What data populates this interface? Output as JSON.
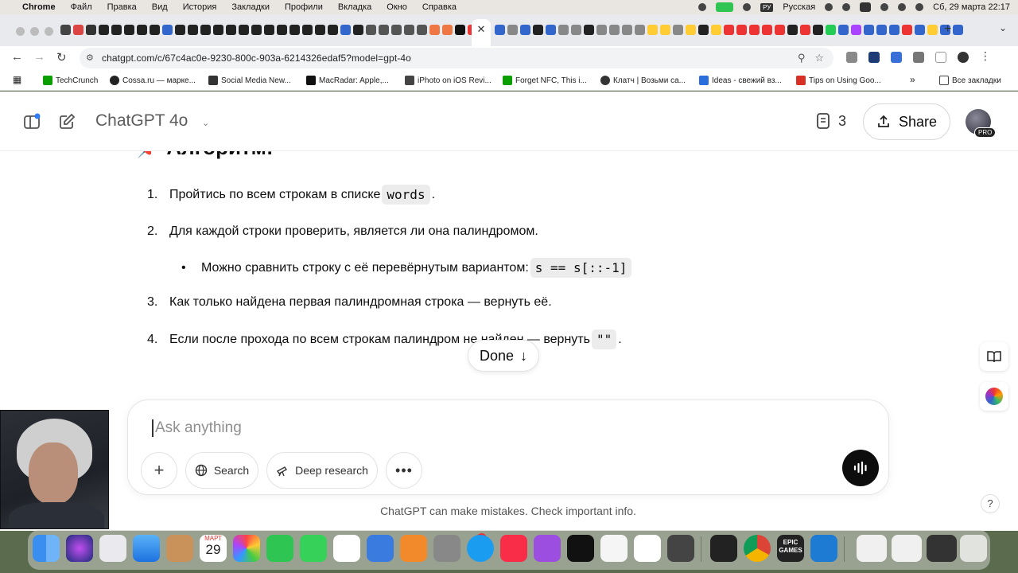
{
  "menubar": {
    "app": "Chrome",
    "items": [
      "Файл",
      "Правка",
      "Вид",
      "История",
      "Закладки",
      "Профили",
      "Вкладка",
      "Окно",
      "Справка"
    ],
    "keyboard_badge": "РУ",
    "keyboard_layout": "Русская",
    "datetime": "Сб, 29 марта  22:17"
  },
  "toolbar": {
    "url": "chatgpt.com/c/67c4ac0e-9230-800c-903a-6214326edaf5?model=gpt-4o"
  },
  "bookmarks": [
    {
      "label": "TechCrunch",
      "color": "#0a9e01"
    },
    {
      "label": "Cossa.ru — марке...",
      "color": "#222222"
    },
    {
      "label": "Social Media New...",
      "color": "#333333"
    },
    {
      "label": "MacRadar: Apple,...",
      "color": "#111111"
    },
    {
      "label": "iPhoto on iOS Revi...",
      "color": "#444444"
    },
    {
      "label": "Forget NFC, This i...",
      "color": "#0a9e01"
    },
    {
      "label": "Клатч | Возьми са...",
      "color": "#333333"
    },
    {
      "label": "Ideas - свежий вз...",
      "color": "#2a6fdb"
    },
    {
      "label": "Tips on Using Goo...",
      "color": "#d93025"
    }
  ],
  "all_bookmarks": "Все закладки",
  "header": {
    "model": "ChatGPT 4o",
    "doc_count": "3",
    "share_label": "Share",
    "pro_badge": "PRO"
  },
  "content": {
    "heading": "Алгоритм:",
    "steps": [
      {
        "num": "1.",
        "text_before": "Пройтись по всем строкам в списке ",
        "code": "words",
        "text_after": "."
      },
      {
        "num": "2.",
        "text_before": "Для каждой строки проверить, является ли она палиндромом.",
        "code": "",
        "text_after": ""
      },
      {
        "num": "3.",
        "text_before": "Как только найдена первая палиндромная строка — вернуть её.",
        "code": "",
        "text_after": ""
      },
      {
        "num": "4.",
        "text_before": "Если после прохода по всем строкам палиндром не найден — вернуть ",
        "code": "\"\"",
        "text_after": "."
      }
    ],
    "bullet": {
      "text_before": "Можно сравнить строку с её перевёрнутым вариантом: ",
      "code": "s == s[::-1]"
    }
  },
  "done_label": "Done",
  "composer": {
    "placeholder": "Ask anything",
    "search_label": "Search",
    "deep_research_label": "Deep research"
  },
  "disclaimer": "ChatGPT can make mistakes. Check important info.",
  "help": "?",
  "dock": {
    "calendar_month": "МАРТ",
    "calendar_day": "29",
    "app_store_badge": "1",
    "epic_label": "EPIC GAMES"
  }
}
